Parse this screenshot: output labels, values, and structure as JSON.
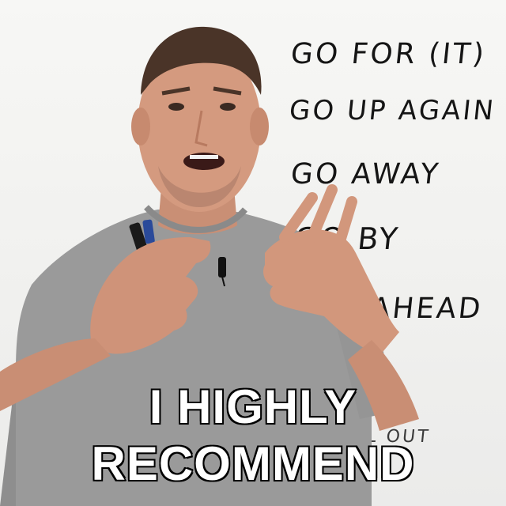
{
  "whiteboard": {
    "lines": [
      "GO FOR (IT)",
      "GO UP AGAIN",
      "GO AWAY",
      "GO BY",
      "GO AHEAD",
      "ALL OUT"
    ]
  },
  "caption": {
    "line1": "I HIGHLY",
    "line2": "RECOMMEND"
  }
}
